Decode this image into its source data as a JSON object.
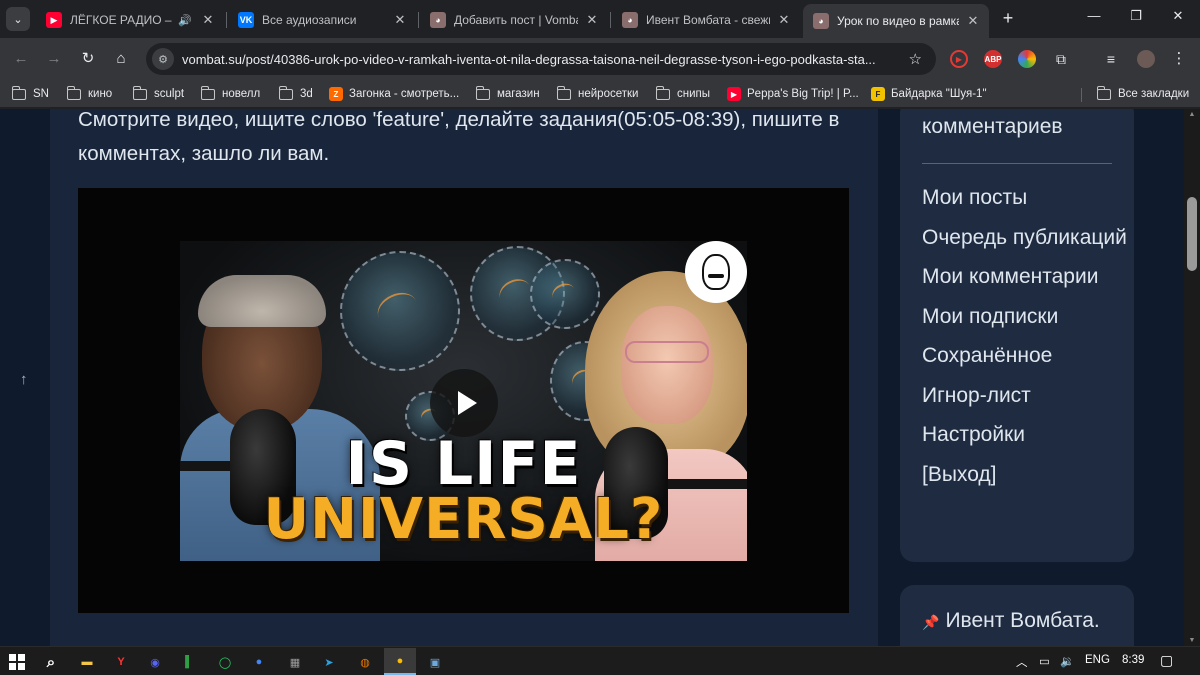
{
  "browser": {
    "tabs": [
      {
        "title": "ЛЁГКОЕ РАДИО – сл",
        "favicon": "youtube-icon",
        "color": "#ff0033",
        "audio": true,
        "active": false
      },
      {
        "title": "Все аудиозаписи",
        "favicon": "vk-icon",
        "color": "#0077ff",
        "audio": false,
        "active": false
      },
      {
        "title": "Добавить пост | Vombat",
        "favicon": "vombat-icon",
        "color": "#8a6d6d",
        "audio": false,
        "active": false
      },
      {
        "title": "Ивент Вомбата - свежи",
        "favicon": "vombat-icon",
        "color": "#8a6d6d",
        "audio": false,
        "active": false
      },
      {
        "title": "Урок по видео в рамках",
        "favicon": "vombat-icon",
        "color": "#8a6d6d",
        "audio": false,
        "active": true
      }
    ],
    "url": "vombat.su/post/40386-urok-po-video-v-ramkah-iventa-ot-nila-degrassa-taisona-neil-degrasse-tyson-i-ego-podkasta-sta...",
    "extensions": [
      {
        "name": "record-extension-icon",
        "label": "",
        "color": "#e53935"
      },
      {
        "name": "adblock-plus-icon",
        "label": "ABP",
        "color": "#d32f2f"
      },
      {
        "name": "color-extension-icon",
        "label": "",
        "color": "#3dbd5c"
      }
    ],
    "bookmarks": [
      {
        "label": "SN",
        "type": "folder"
      },
      {
        "label": "кино",
        "type": "folder"
      },
      {
        "label": "sculpt",
        "type": "folder"
      },
      {
        "label": "новелл",
        "type": "folder"
      },
      {
        "label": "3d",
        "type": "folder"
      },
      {
        "label": "Загонка - смотреть...",
        "type": "link",
        "icon": "zagonka-icon",
        "color": "#ff6a00",
        "glyph": "Z"
      },
      {
        "label": "магазин",
        "type": "folder"
      },
      {
        "label": "нейросетки",
        "type": "folder"
      },
      {
        "label": "снипы",
        "type": "folder"
      },
      {
        "label": "Peppa's Big Trip! | P...",
        "type": "link",
        "icon": "youtube-icon",
        "color": "#ff0033",
        "glyph": "▶"
      },
      {
        "label": "Байдарка \"Шуя-1\"",
        "type": "link",
        "icon": "baidarka-icon",
        "color": "#f2c200",
        "glyph": "F"
      }
    ],
    "all_bookmarks": "Все закладки"
  },
  "post": {
    "text": "Смотрите видео, ищите слово 'feature', делайте задания(05:05-08:39), пишите в комментах, зашло ли вам.",
    "video": {
      "thumbnail_line1": "IS LIFE",
      "thumbnail_line2": "UNIVERSAL?"
    }
  },
  "sidebar": {
    "heading": "комментариев",
    "links": [
      "Мои посты",
      "Очередь публикаций",
      "Мои комментарии",
      "Мои подписки",
      "Сохранённое",
      "Игнор-лист",
      "Настройки",
      "[Выход]"
    ],
    "pinned": "Ивент Вомбата."
  },
  "taskbar": {
    "apps": [
      {
        "name": "file-explorer-icon",
        "color": "#f3c648",
        "glyph": "▬"
      },
      {
        "name": "yandex-browser-icon",
        "color": "#ff3333",
        "glyph": "Y"
      },
      {
        "name": "discord-icon",
        "color": "#5865f2",
        "glyph": "◉"
      },
      {
        "name": "app-green-icon",
        "color": "#2ea043",
        "glyph": "▌"
      },
      {
        "name": "whatsapp-icon",
        "color": "#25d366",
        "glyph": "◯"
      },
      {
        "name": "chrome-blue-icon",
        "color": "#4285f4",
        "glyph": "●"
      },
      {
        "name": "calculator-icon",
        "color": "#7a7a7a",
        "glyph": "▦"
      },
      {
        "name": "telegram-icon",
        "color": "#2aa3df",
        "glyph": "➤"
      },
      {
        "name": "blender-icon",
        "color": "#ea7600",
        "glyph": "◍"
      },
      {
        "name": "chrome-icon",
        "color": "#fbbc04",
        "glyph": "●",
        "active": true
      },
      {
        "name": "photos-icon",
        "color": "#6fa8dc",
        "glyph": "▣"
      }
    ],
    "language": "ENG",
    "time": "8:39"
  }
}
